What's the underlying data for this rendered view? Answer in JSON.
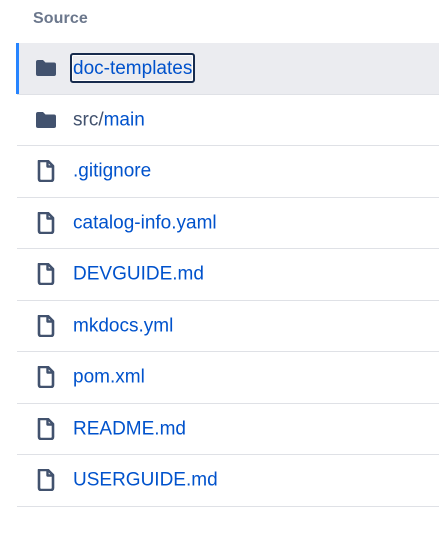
{
  "section": {
    "title": "Source"
  },
  "files": [
    {
      "type": "folder",
      "icon": "folder-icon",
      "prefix": "",
      "name": "doc-templates",
      "selected": true
    },
    {
      "type": "folder",
      "icon": "folder-icon",
      "prefix": "src/",
      "name": "main",
      "selected": false
    },
    {
      "type": "file",
      "icon": "file-icon",
      "prefix": "",
      "name": ".gitignore",
      "selected": false
    },
    {
      "type": "file",
      "icon": "file-icon",
      "prefix": "",
      "name": "catalog-info.yaml",
      "selected": false
    },
    {
      "type": "file",
      "icon": "file-icon",
      "prefix": "",
      "name": "DEVGUIDE.md",
      "selected": false
    },
    {
      "type": "file",
      "icon": "file-icon",
      "prefix": "",
      "name": "mkdocs.yml",
      "selected": false
    },
    {
      "type": "file",
      "icon": "file-icon",
      "prefix": "",
      "name": "pom.xml",
      "selected": false
    },
    {
      "type": "file",
      "icon": "file-icon",
      "prefix": "",
      "name": "README.md",
      "selected": false
    },
    {
      "type": "file",
      "icon": "file-icon",
      "prefix": "",
      "name": "USERGUIDE.md",
      "selected": false
    }
  ],
  "colors": {
    "link": "#0052cc",
    "selected_bg": "#ebecf0",
    "selected_accent": "#2684ff",
    "icon": "#42526e",
    "divider": "#dfe1e6"
  }
}
